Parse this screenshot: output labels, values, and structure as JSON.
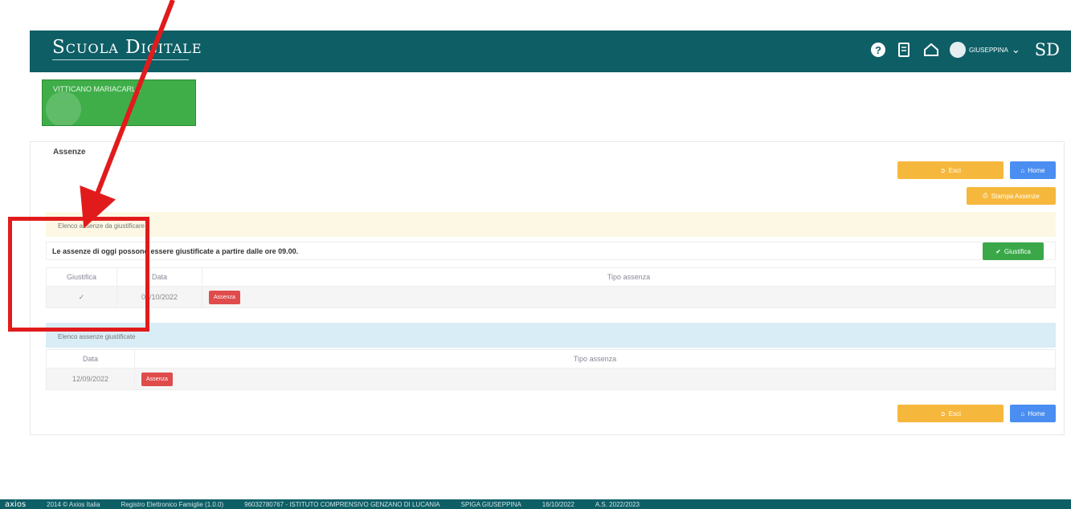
{
  "header": {
    "brand": "Scuola Digitale",
    "user_name": "GIUSEPPINA",
    "logo": "SD",
    "icons": [
      "help-icon",
      "book-icon",
      "home-icon",
      "user-avatar",
      "chevron-down-icon"
    ]
  },
  "student": {
    "name": "VITTICANO MARIACARLA"
  },
  "section": {
    "title": "Assenze",
    "button_esci": "Esci",
    "button_home": "Home",
    "button_stampa": "Stampa Assenze"
  },
  "unjustified": {
    "header": "Elenco assenze da giustificare",
    "notice": "Le assenze di oggi possono essere giustificate a partire dalle ore 09.00.",
    "button_giustifica": "Giustifica",
    "columns": [
      "Giustifica",
      "Data",
      "Tipo assenza"
    ],
    "rows": [
      {
        "check": "✓",
        "date": "03/10/2022",
        "type": "Assenza"
      }
    ]
  },
  "justified": {
    "header": "Elenco assenze giustificate",
    "columns": [
      "Data",
      "Tipo assenza"
    ],
    "rows": [
      {
        "date": "12/09/2022",
        "type": "Assenza"
      }
    ]
  },
  "footer": {
    "logo": "axios",
    "copyright": "2014 © Axios Italia",
    "app": "Registro Elettronico Famiglie (1.0.0)",
    "school": "96032780767 - ISTITUTO COMPRENSIVO GENZANO DI LUCANIA",
    "user": "SPIGA GIUSEPPINA",
    "date": "16/10/2022",
    "year": "A.S. 2022/2023"
  },
  "colors": {
    "header_bg": "#0e5e66",
    "student_card": "#3fae49",
    "button_orange": "#f6b83c",
    "button_blue": "#4a8ef2",
    "button_green": "#3aa849",
    "badge_red": "#e04b4b",
    "annotation_red": "#e11b1b"
  }
}
